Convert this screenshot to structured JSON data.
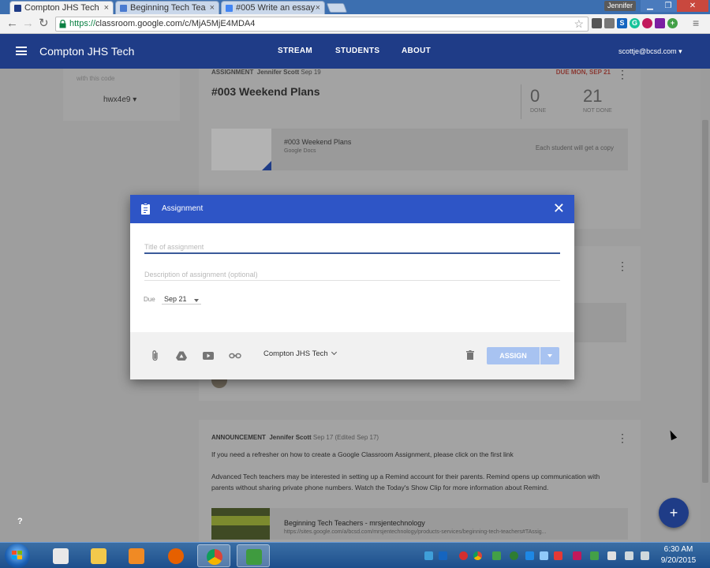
{
  "browser": {
    "tabs": [
      {
        "title": "Compton JHS Tech",
        "active": true
      },
      {
        "title": "Beginning Tech Tea",
        "active": false
      },
      {
        "title": "#005 Write an essay",
        "active": false
      }
    ],
    "close_glyph": "×",
    "profile": "Jennifer",
    "window_controls": {
      "minimize": "▁",
      "restore": "❐",
      "close": "✕"
    },
    "nav": {
      "back": "←",
      "forward": "→",
      "reload": "↻"
    },
    "url_scheme": "https://",
    "url_rest": "classroom.google.com/c/MjA5MjE4MDA4",
    "star": "☆",
    "extensions": [
      {
        "name": "screen-capture-icon",
        "color": "#555555",
        "glyph": ""
      },
      {
        "name": "cast-icon",
        "color": "#666666",
        "glyph": ""
      },
      {
        "name": "s-extension-icon",
        "color": "#1565c0",
        "glyph": "S"
      },
      {
        "name": "grammarly-icon",
        "color": "#15c39a",
        "glyph": "G"
      },
      {
        "name": "pocket-icon",
        "color": "#c2185b",
        "glyph": ""
      },
      {
        "name": "onenote-icon",
        "color": "#7b1fa2",
        "glyph": ""
      },
      {
        "name": "plus-extension-icon",
        "color": "#43a047",
        "glyph": "+"
      }
    ],
    "menu_glyph": "≡"
  },
  "app": {
    "class_name": "Compton JHS Tech",
    "tabs": [
      "STREAM",
      "STUDENTS",
      "ABOUT"
    ],
    "account": "scottje@bcsd.com",
    "accent": "#1f3c87"
  },
  "class_code": {
    "caption": "with this code",
    "code": "hwx4e9"
  },
  "assignment_post": {
    "kind": "ASSIGNMENT",
    "author": "Jennifer Scott",
    "date": "Sep 19",
    "due": "DUE MON, SEP 21",
    "title": "#003 Weekend Plans",
    "done_count": "0",
    "done_label": "DONE",
    "not_done_count": "21",
    "not_done_label": "NOT DONE",
    "attachment": {
      "name": "#003 Weekend Plans",
      "type": "Google Docs",
      "share": "Each student will get a copy"
    }
  },
  "announcement": {
    "kind": "ANNOUNCEMENT",
    "author": "Jennifer Scott",
    "date": "Sep 17 (Edited Sep 17)",
    "text1": "If you need a refresher on how to create a Google Classroom Assignment, please click on the first link",
    "text2": "Advanced Tech teachers may be interested in setting up a Remind account for their parents. Remind opens up communication with parents without sharing private phone numbers. Watch the Today's Show Clip for more information about Remind.",
    "link_title": "Beginning Tech Teachers - mrsjentechnology",
    "link_url": "https://sites.google.com/a/bcsd.com/mrsjentechnology/products-services/beginning-tech-teachers#TAssig..."
  },
  "kebab": "⋮",
  "help": "?",
  "fab": "+",
  "dialog": {
    "title": "Assignment",
    "close": "✕",
    "title_placeholder": "Title of assignment",
    "description_placeholder": "Description of assignment (optional)",
    "due_label": "Due",
    "due_value": "Sep 21",
    "class_select": "Compton JHS Tech",
    "assign_button": "ASSIGN",
    "header_color": "#2e55c6"
  },
  "taskbar": {
    "time": "6:30 AM",
    "date": "9/20/2015"
  }
}
